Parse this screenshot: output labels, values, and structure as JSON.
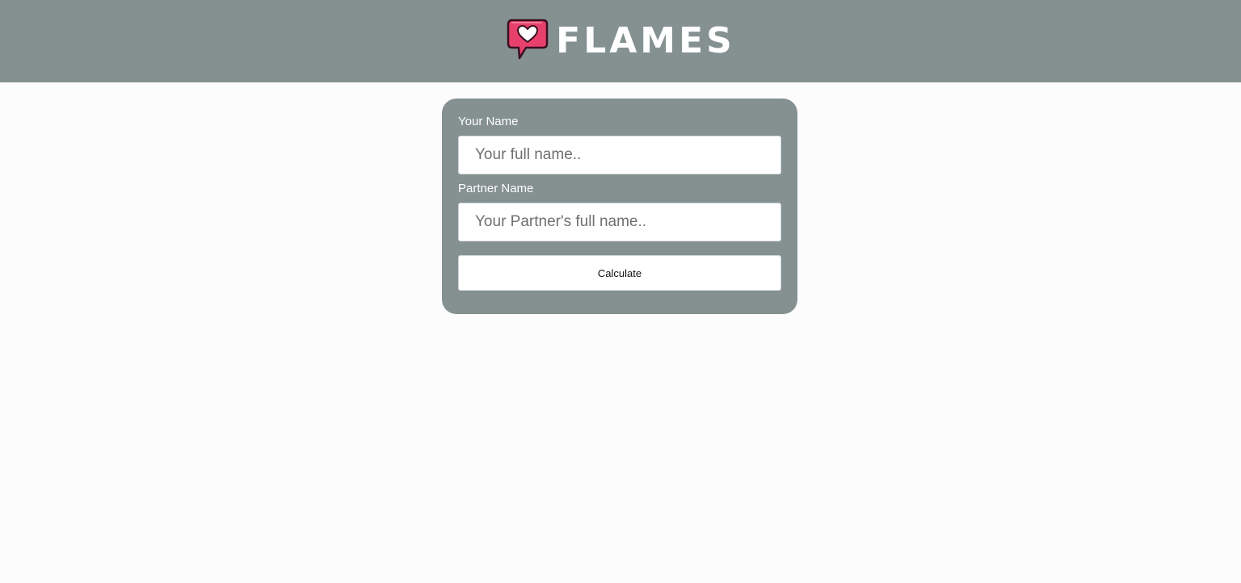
{
  "header": {
    "logo_icon": "heart-speech-bubble-icon",
    "title": "FLAMES",
    "colors": {
      "bar": "#859091",
      "logo_fill": "#e8406c"
    }
  },
  "form": {
    "your_name_label": "Your Name",
    "your_name_placeholder": "Your full name..",
    "your_name_value": "",
    "partner_name_label": "Partner Name",
    "partner_name_placeholder": "Your Partner's full name..",
    "partner_name_value": "",
    "calculate_label": "Calculate"
  }
}
